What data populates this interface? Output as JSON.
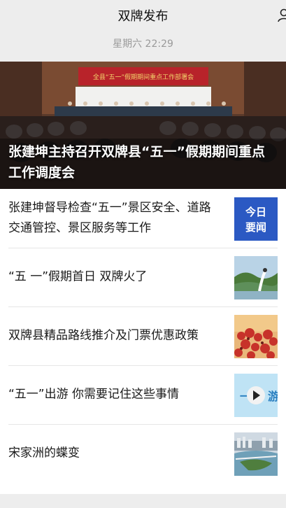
{
  "header": {
    "title": "双牌发布",
    "user_icon": "user-icon"
  },
  "timestamp": "星期六 22:29",
  "hero": {
    "banner_text": "全县“五一”假期期间重点工作部署会",
    "title": "张建坤主持召开双牌县“五一”假期期间重点工作调度会"
  },
  "articles": [
    {
      "title": "张建坤督导检查“五一”景区安全、道路交通管控、景区服务等工作",
      "thumb": "today-news-badge",
      "thumb_text": [
        "今日",
        "要闻"
      ]
    },
    {
      "title": "“五 一”假期首日 双牌火了",
      "thumb": "water-jet-photo"
    },
    {
      "title": "双牌县精品路线推介及门票优惠政策",
      "thumb": "red-flowers-photo"
    },
    {
      "title": "“五一”出游 你需要记住这些事情",
      "thumb": "video-thumbnail",
      "thumb_text": [
        "一",
        "游"
      ]
    },
    {
      "title": "宋家洲的蝶变",
      "thumb": "river-town-photo"
    }
  ],
  "colors": {
    "badge_blue": "#2b59c3",
    "background": "#ededed"
  }
}
